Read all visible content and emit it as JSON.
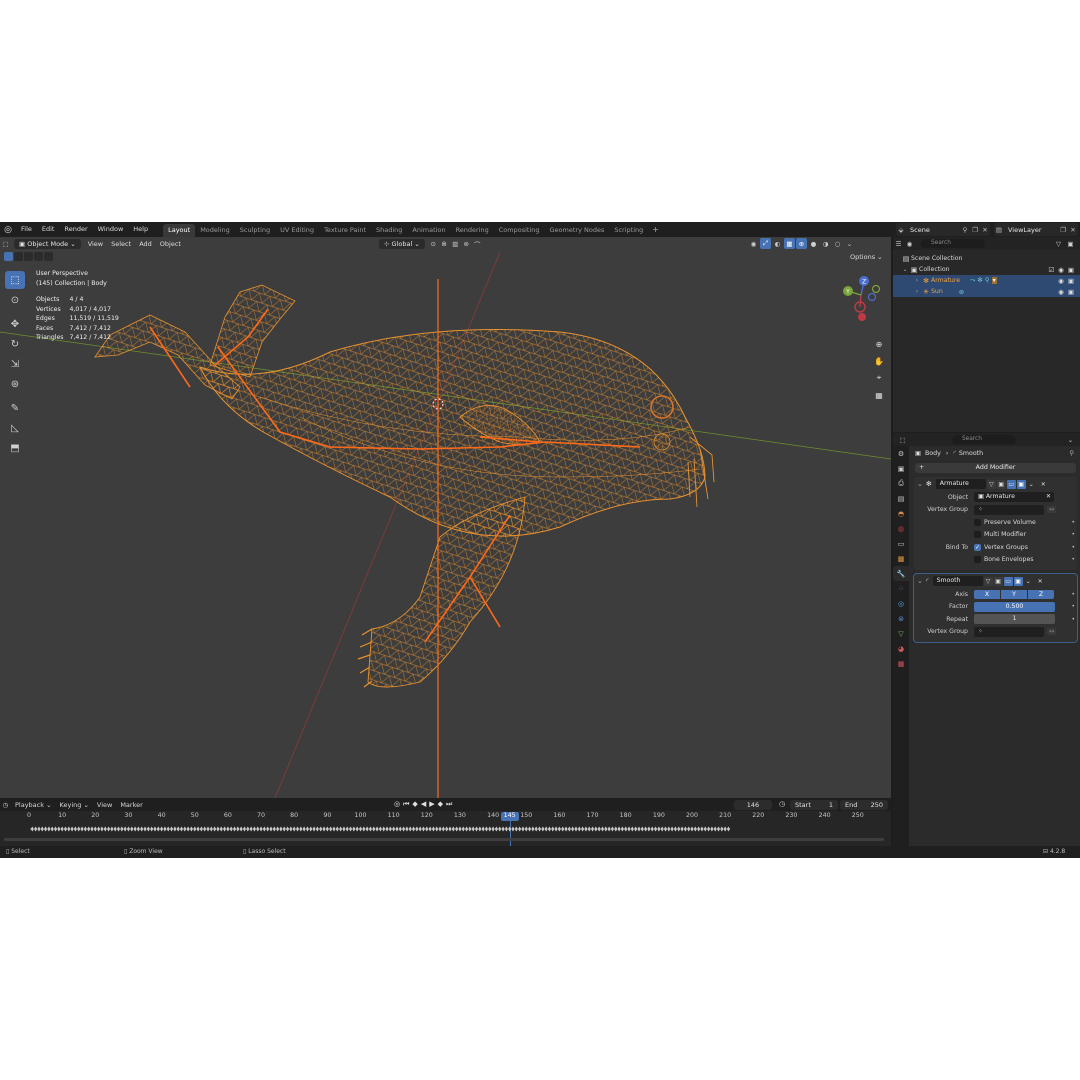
{
  "topbar": {
    "logo_icon": "blender-logo-icon",
    "menus": [
      "File",
      "Edit",
      "Render",
      "Window",
      "Help"
    ],
    "workspaces": [
      "Layout",
      "Modeling",
      "Sculpting",
      "UV Editing",
      "Texture Paint",
      "Shading",
      "Animation",
      "Rendering",
      "Compositing",
      "Geometry Nodes",
      "Scripting"
    ],
    "active_workspace": "Layout",
    "add_workspace": "+",
    "scene": "Scene",
    "view_layer": "ViewLayer"
  },
  "viewport": {
    "mode": "Object Mode",
    "menus": [
      "View",
      "Select",
      "Add",
      "Object"
    ],
    "orientation": "Global",
    "options": "Options",
    "info_line1": "User Perspective",
    "info_line2": "(145) Collection | Body",
    "stats": [
      {
        "label": "Objects",
        "value": "4 / 4"
      },
      {
        "label": "Vertices",
        "value": "4,017 / 4,017"
      },
      {
        "label": "Edges",
        "value": "11,519 / 11,519"
      },
      {
        "label": "Faces",
        "value": "7,412 / 7,412"
      },
      {
        "label": "Triangles",
        "value": "7,412 / 7,412"
      }
    ],
    "tools": [
      "select-box-icon",
      "cursor-icon",
      "move-icon",
      "rotate-icon",
      "scale-icon",
      "transform-icon",
      "annotate-icon",
      "measure-icon",
      "add-cube-icon"
    ],
    "gizmo_labels": {
      "z": "Z",
      "y": "Y",
      "x": "X"
    },
    "colors": {
      "background": "#3d3d3d",
      "wire": "#e8922f",
      "bone": "#ff6a1a",
      "x_axis": "#8a3a3a",
      "y_axis": "#6e8f2e"
    }
  },
  "timeline": {
    "menus": [
      "Playback",
      "Keying",
      "View",
      "Marker"
    ],
    "current_frame": "146",
    "start_label": "Start",
    "start": "1",
    "end_label": "End",
    "end": "250",
    "ruler_ticks": [
      "0",
      "10",
      "20",
      "30",
      "40",
      "50",
      "60",
      "70",
      "80",
      "90",
      "100",
      "110",
      "120",
      "130",
      "140",
      "150",
      "160",
      "170",
      "180",
      "190",
      "200",
      "210",
      "220",
      "230",
      "240",
      "250"
    ],
    "playhead_frame": "145",
    "keyframe_range": [
      0,
      212
    ]
  },
  "statusbar": {
    "left": "Select",
    "middle": "Zoom View",
    "right": "Lasso Select",
    "version": "4.2.8"
  },
  "outliner": {
    "search_placeholder": "Search",
    "rows": [
      {
        "label": "Scene Collection",
        "icon": "scene-collection-icon"
      },
      {
        "label": "Collection",
        "icon": "collection-icon"
      },
      {
        "label": "Armature",
        "icon": "armature-icon"
      },
      {
        "label": "Sun",
        "icon": "sun-icon"
      }
    ]
  },
  "properties": {
    "search_placeholder": "Search",
    "breadcrumb_object": "Body",
    "breadcrumb_modifier": "Smooth",
    "add_modifier": "Add Modifier",
    "armature_mod": {
      "name": "Armature",
      "object_label": "Object",
      "object_value": "Armature",
      "vertex_group_label": "Vertex Group",
      "preserve_volume": "Preserve Volume",
      "multi_modifier": "Multi Modifier",
      "bind_to_label": "Bind To",
      "vertex_groups": "Vertex Groups",
      "bone_envelopes": "Bone Envelopes"
    },
    "smooth_mod": {
      "name": "Smooth",
      "axis_label": "Axis",
      "axes": [
        "X",
        "Y",
        "Z"
      ],
      "factor_label": "Factor",
      "factor_value": "0.500",
      "repeat_label": "Repeat",
      "repeat_value": "1",
      "vertex_group_label": "Vertex Group"
    }
  }
}
